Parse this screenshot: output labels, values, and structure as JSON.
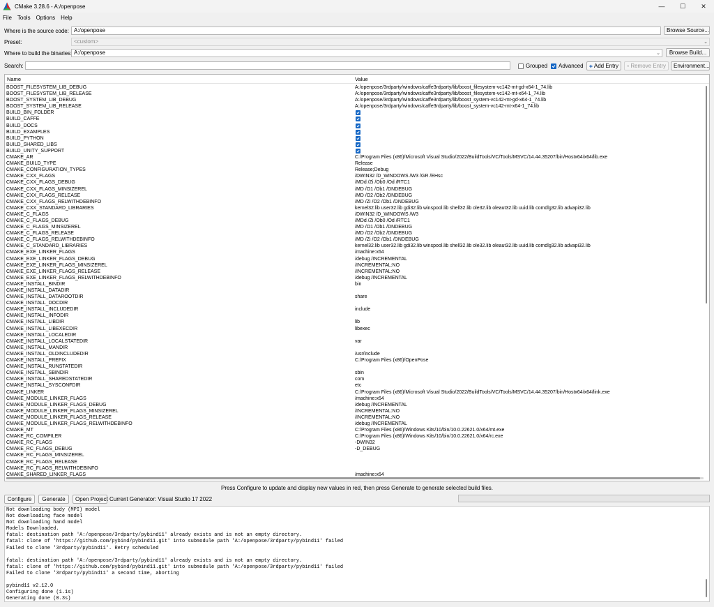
{
  "window": {
    "title": "CMake 3.28.6 - A:/openpose"
  },
  "menu": [
    "File",
    "Tools",
    "Options",
    "Help"
  ],
  "source": {
    "label": "Where is the source code:",
    "value": "A:/openpose",
    "browse_label": "Browse Source..."
  },
  "preset": {
    "label": "Preset:",
    "value": "<custom>"
  },
  "build": {
    "label": "Where to build the binaries:",
    "value": "A:/openpose",
    "browse_label": "Browse Build..."
  },
  "search": {
    "label": "Search:",
    "value": ""
  },
  "options": {
    "grouped_label": "Grouped",
    "grouped_checked": false,
    "advanced_label": "Advanced",
    "advanced_checked": true,
    "add_entry_label": "Add Entry",
    "remove_entry_label": "Remove Entry",
    "environment_label": "Environment..."
  },
  "table": {
    "columns": {
      "name": "Name",
      "value": "Value"
    },
    "rows": [
      {
        "name": "BOOST_FILESYSTEM_LIB_DEBUG",
        "value": "A:/openpose/3rdparty/windows/caffe3rdparty/lib/boost_filesystem-vc142-mt-gd-x64-1_74.lib"
      },
      {
        "name": "BOOST_FILESYSTEM_LIB_RELEASE",
        "value": "A:/openpose/3rdparty/windows/caffe3rdparty/lib/boost_filesystem-vc142-mt-x64-1_74.lib"
      },
      {
        "name": "BOOST_SYSTEM_LIB_DEBUG",
        "value": "A:/openpose/3rdparty/windows/caffe3rdparty/lib/boost_system-vc142-mt-gd-x64-1_74.lib"
      },
      {
        "name": "BOOST_SYSTEM_LIB_RELEASE",
        "value": "A:/openpose/3rdparty/windows/caffe3rdparty/lib/boost_system-vc142-mt-x64-1_74.lib"
      },
      {
        "name": "BUILD_BIN_FOLDER",
        "checked": true
      },
      {
        "name": "BUILD_CAFFE",
        "checked": true
      },
      {
        "name": "BUILD_DOCS",
        "checked": true
      },
      {
        "name": "BUILD_EXAMPLES",
        "checked": true
      },
      {
        "name": "BUILD_PYTHON",
        "checked": true
      },
      {
        "name": "BUILD_SHARED_LIBS",
        "checked": true
      },
      {
        "name": "BUILD_UNITY_SUPPORT",
        "checked": true
      },
      {
        "name": "CMAKE_AR",
        "value": "C:/Program Files (x86)/Microsoft Visual Studio/2022/BuildTools/VC/Tools/MSVC/14.44.35207/bin/Hostx64/x64/lib.exe"
      },
      {
        "name": "CMAKE_BUILD_TYPE",
        "value": "Release"
      },
      {
        "name": "CMAKE_CONFIGURATION_TYPES",
        "value": "Release;Debug"
      },
      {
        "name": "CMAKE_CXX_FLAGS",
        "value": "/DWIN32 /D_WINDOWS /W3 /GR /EHsc"
      },
      {
        "name": "CMAKE_CXX_FLAGS_DEBUG",
        "value": "/MDd /Zi /Ob0 /Od /RTC1"
      },
      {
        "name": "CMAKE_CXX_FLAGS_MINSIZEREL",
        "value": "/MD /O1 /Ob1 /DNDEBUG"
      },
      {
        "name": "CMAKE_CXX_FLAGS_RELEASE",
        "value": "/MD /O2 /Ob2 /DNDEBUG"
      },
      {
        "name": "CMAKE_CXX_FLAGS_RELWITHDEBINFO",
        "value": "/MD /Zi /O2 /Ob1 /DNDEBUG"
      },
      {
        "name": "CMAKE_CXX_STANDARD_LIBRARIES",
        "value": "kernel32.lib user32.lib gdi32.lib winspool.lib shell32.lib ole32.lib oleaut32.lib uuid.lib comdlg32.lib advapi32.lib"
      },
      {
        "name": "CMAKE_C_FLAGS",
        "value": "/DWIN32 /D_WINDOWS /W3"
      },
      {
        "name": "CMAKE_C_FLAGS_DEBUG",
        "value": "/MDd /Zi /Ob0 /Od /RTC1"
      },
      {
        "name": "CMAKE_C_FLAGS_MINSIZEREL",
        "value": "/MD /O1 /Ob1 /DNDEBUG"
      },
      {
        "name": "CMAKE_C_FLAGS_RELEASE",
        "value": "/MD /O2 /Ob2 /DNDEBUG"
      },
      {
        "name": "CMAKE_C_FLAGS_RELWITHDEBINFO",
        "value": "/MD /Zi /O2 /Ob1 /DNDEBUG"
      },
      {
        "name": "CMAKE_C_STANDARD_LIBRARIES",
        "value": "kernel32.lib user32.lib gdi32.lib winspool.lib shell32.lib ole32.lib oleaut32.lib uuid.lib comdlg32.lib advapi32.lib"
      },
      {
        "name": "CMAKE_EXE_LINKER_FLAGS",
        "value": "/machine:x64"
      },
      {
        "name": "CMAKE_EXE_LINKER_FLAGS_DEBUG",
        "value": "/debug /INCREMENTAL"
      },
      {
        "name": "CMAKE_EXE_LINKER_FLAGS_MINSIZEREL",
        "value": "/INCREMENTAL:NO"
      },
      {
        "name": "CMAKE_EXE_LINKER_FLAGS_RELEASE",
        "value": "/INCREMENTAL:NO"
      },
      {
        "name": "CMAKE_EXE_LINKER_FLAGS_RELWITHDEBINFO",
        "value": "/debug /INCREMENTAL"
      },
      {
        "name": "CMAKE_INSTALL_BINDIR",
        "value": "bin"
      },
      {
        "name": "CMAKE_INSTALL_DATADIR",
        "value": ""
      },
      {
        "name": "CMAKE_INSTALL_DATAROOTDIR",
        "value": "share"
      },
      {
        "name": "CMAKE_INSTALL_DOCDIR",
        "value": ""
      },
      {
        "name": "CMAKE_INSTALL_INCLUDEDIR",
        "value": "include"
      },
      {
        "name": "CMAKE_INSTALL_INFODIR",
        "value": ""
      },
      {
        "name": "CMAKE_INSTALL_LIBDIR",
        "value": "lib"
      },
      {
        "name": "CMAKE_INSTALL_LIBEXECDIR",
        "value": "libexec"
      },
      {
        "name": "CMAKE_INSTALL_LOCALEDIR",
        "value": ""
      },
      {
        "name": "CMAKE_INSTALL_LOCALSTATEDIR",
        "value": "var"
      },
      {
        "name": "CMAKE_INSTALL_MANDIR",
        "value": ""
      },
      {
        "name": "CMAKE_INSTALL_OLDINCLUDEDIR",
        "value": "/usr/include"
      },
      {
        "name": "CMAKE_INSTALL_PREFIX",
        "value": "C:/Program Files (x86)/OpenPose"
      },
      {
        "name": "CMAKE_INSTALL_RUNSTATEDIR",
        "value": ""
      },
      {
        "name": "CMAKE_INSTALL_SBINDIR",
        "value": "sbin"
      },
      {
        "name": "CMAKE_INSTALL_SHAREDSTATEDIR",
        "value": "com"
      },
      {
        "name": "CMAKE_INSTALL_SYSCONFDIR",
        "value": "etc"
      },
      {
        "name": "CMAKE_LINKER",
        "value": "C:/Program Files (x86)/Microsoft Visual Studio/2022/BuildTools/VC/Tools/MSVC/14.44.35207/bin/Hostx64/x64/link.exe"
      },
      {
        "name": "CMAKE_MODULE_LINKER_FLAGS",
        "value": "/machine:x64"
      },
      {
        "name": "CMAKE_MODULE_LINKER_FLAGS_DEBUG",
        "value": "/debug /INCREMENTAL"
      },
      {
        "name": "CMAKE_MODULE_LINKER_FLAGS_MINSIZEREL",
        "value": "/INCREMENTAL:NO"
      },
      {
        "name": "CMAKE_MODULE_LINKER_FLAGS_RELEASE",
        "value": "/INCREMENTAL:NO"
      },
      {
        "name": "CMAKE_MODULE_LINKER_FLAGS_RELWITHDEBINFO",
        "value": "/debug /INCREMENTAL"
      },
      {
        "name": "CMAKE_MT",
        "value": "C:/Program Files (x86)/Windows Kits/10/bin/10.0.22621.0/x64/mt.exe"
      },
      {
        "name": "CMAKE_RC_COMPILER",
        "value": "C:/Program Files (x86)/Windows Kits/10/bin/10.0.22621.0/x64/rc.exe"
      },
      {
        "name": "CMAKE_RC_FLAGS",
        "value": "-DWIN32"
      },
      {
        "name": "CMAKE_RC_FLAGS_DEBUG",
        "value": "-D_DEBUG"
      },
      {
        "name": "CMAKE_RC_FLAGS_MINSIZEREL",
        "value": ""
      },
      {
        "name": "CMAKE_RC_FLAGS_RELEASE",
        "value": ""
      },
      {
        "name": "CMAKE_RC_FLAGS_RELWITHDEBINFO",
        "value": ""
      },
      {
        "name": "CMAKE_SHARED_LINKER_FLAGS",
        "value": "/machine:x64"
      }
    ]
  },
  "hint": "Press Configure to update and display new values in red, then press Generate to generate selected build files.",
  "actions": {
    "configure_label": "Configure",
    "generate_label": "Generate",
    "open_project_label": "Open Project",
    "current_generator": "Current Generator: Visual Studio 17 2022"
  },
  "log": [
    "Not downloading body (MPI) model",
    "Not downloading face model",
    "Not downloading hand model",
    "Models Downloaded.",
    "fatal: destination path 'A:/openpose/3rdparty/pybind11' already exists and is not an empty directory.",
    "fatal: clone of 'https://github.com/pybind/pybind11.git' into submodule path 'A:/openpose/3rdparty/pybind11' failed",
    "Failed to clone '3rdparty/pybind11'. Retry scheduled",
    "",
    "fatal: destination path 'A:/openpose/3rdparty/pybind11' already exists and is not an empty directory.",
    "fatal: clone of 'https://github.com/pybind/pybind11.git' into submodule path 'A:/openpose/3rdparty/pybind11' failed",
    "Failed to clone '3rdparty/pybind11' a second time, aborting",
    "",
    "pybind11 v2.12.0",
    "Configuring done (1.1s)",
    "Generating done (0.3s)"
  ],
  "colors": {
    "accent": "#1466c4",
    "window_bg": "#f0f0f0"
  }
}
